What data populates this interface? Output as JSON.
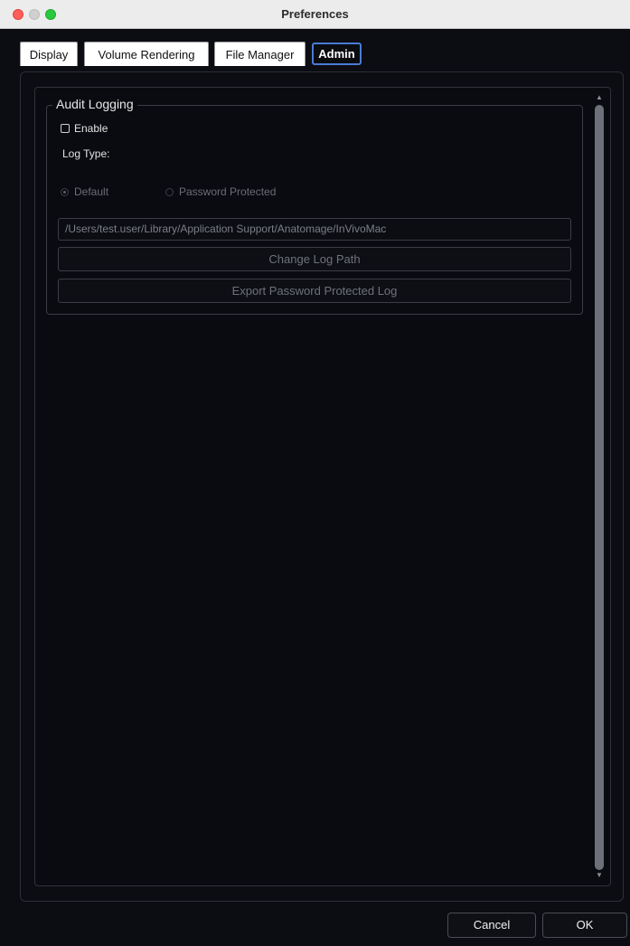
{
  "window": {
    "title": "Preferences"
  },
  "tabs": [
    {
      "label": "Display"
    },
    {
      "label": "Volume Rendering"
    },
    {
      "label": "File Manager"
    },
    {
      "label": "Admin"
    }
  ],
  "active_tab": "Admin",
  "audit_logging": {
    "group_title": "Audit Logging",
    "enable_label": "Enable",
    "enable_checked": false,
    "log_type_label": "Log Type:",
    "radio_default_label": "Default",
    "radio_password_label": "Password Protected",
    "selected_log_type": "Default",
    "log_path": "/Users/test.user/Library/Application Support/Anatomage/InVivoMac",
    "change_log_path_label": "Change Log Path",
    "export_log_label": "Export Password Protected Log"
  },
  "footer": {
    "cancel_label": "Cancel",
    "ok_label": "OK"
  },
  "colors": {
    "background": "#0b0d12",
    "active_tab_border": "#4a7bd4",
    "close": "#ff5f57",
    "zoom": "#28c840"
  }
}
